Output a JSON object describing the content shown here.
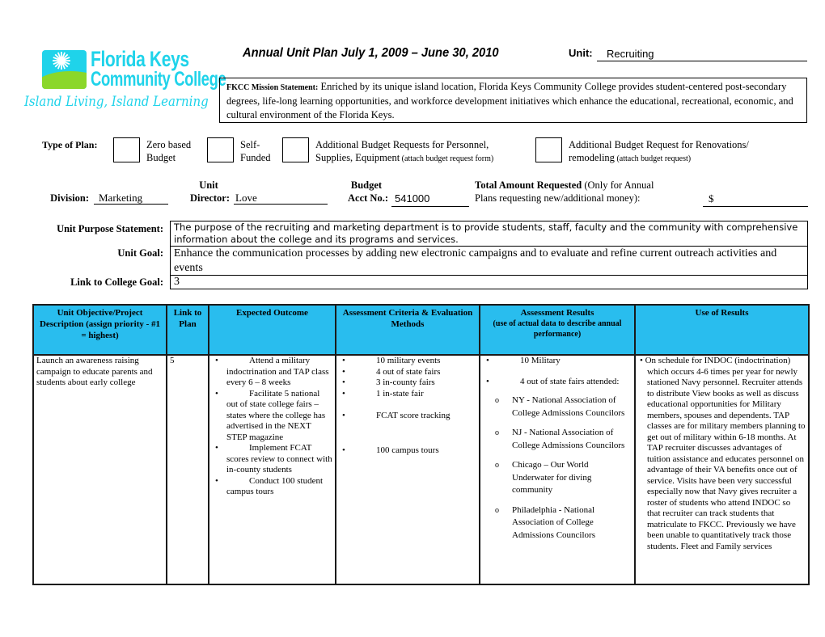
{
  "logo": {
    "line1": "Florida Keys",
    "line2": "Community College",
    "tagline": "Island Living, Island Learning",
    "icon": "dandelion-icon",
    "colors": {
      "cyan": "#1fd3ea",
      "green": "#8bd72a"
    }
  },
  "header": {
    "title": "Annual Unit Plan July 1, 2009 – June 30, 2010",
    "unit_label": "Unit:",
    "unit_value": "Recruiting"
  },
  "mission": {
    "label": "FKCC Mission Statement:",
    "text": " Enriched by its unique island location, Florida Keys Community College provides student-centered post-secondary degrees, life-long learning opportunities, and workforce development initiatives which enhance the educational, recreational, economic, and cultural environment of the Florida Keys."
  },
  "plan_type": {
    "label": "Type of Plan:",
    "options": [
      {
        "line1": "Zero based",
        "line2": "Budget",
        "note": ""
      },
      {
        "line1": "Self-",
        "line2": "Funded",
        "note": ""
      },
      {
        "line1": "Additional Budget Requests for Personnel,",
        "line2": "Supplies, Equipment",
        "note": " (attach budget request form)"
      },
      {
        "line1": "Additional Budget Request for Renovations/",
        "line2": "remodeling",
        "note": " (attach budget request)"
      }
    ]
  },
  "fields": {
    "division_label": "Division:",
    "division_value": "Marketing",
    "director_label_1": "Unit",
    "director_label_2": "Director:",
    "director_value": "Love",
    "acct_label_1": "Budget",
    "acct_label_2": "Acct No.:",
    "acct_value": "541000",
    "total_label_bold": "Total Amount Requested",
    "total_label_rest": " (Only for Annual",
    "total_label_line2": "Plans requesting new/additional money):",
    "total_value": "$"
  },
  "purpose": {
    "purpose_label": "Unit Purpose Statement:",
    "purpose_text": "The purpose of the recruiting and marketing department is to provide students, staff, faculty and the community with comprehensive information about the college and its programs and services.",
    "goal_label": "Unit Goal:",
    "goal_text": "Enhance the communication processes by adding new electronic campaigns and to evaluate and refine current outreach activities and events",
    "link_label": "Link to College Goal:",
    "link_value": "3"
  },
  "table": {
    "header_color": "#29bdee",
    "headers": [
      {
        "title": "Unit Objective/Project Description (assign priority - #1 = highest)",
        "sub": ""
      },
      {
        "title": "Link to Plan",
        "sub": ""
      },
      {
        "title": "Expected Outcome",
        "sub": ""
      },
      {
        "title": "Assessment Criteria & Evaluation Methods",
        "sub": ""
      },
      {
        "title": "Assessment Results",
        "sub": "(use of actual data to describe annual performance)"
      },
      {
        "title": "Use of Results",
        "sub": ""
      }
    ],
    "rows": [
      {
        "objective": "Launch an awareness raising campaign to educate parents and students about early college",
        "link": "5",
        "outcomes": [
          "Attend a military indoctrination and TAP class every 6 – 8 weeks",
          "Facilitate 5 national out of state college fairs – states where the college has advertised in the NEXT STEP magazine",
          "Implement FCAT scores review to connect with in-county students",
          "Conduct 100 student campus tours"
        ],
        "criteria": [
          "10 military events",
          "4 out of state fairs",
          "3 in-county fairs",
          "1 in-state fair",
          "FCAT score tracking",
          "100 campus tours"
        ],
        "results": {
          "items": [
            "10 Military",
            "4 out of state fairs attended:"
          ],
          "sub_items": [
            "NY - National Association of College Admissions Councilors",
            "NJ - National Association of College Admissions Councilors",
            "Chicago – Our World Underwater for diving community",
            "Philadelphia - National Association of College Admissions Councilors"
          ]
        },
        "use_of_results": "On schedule for INDOC (indoctrination) which occurs 4-6 times per year for newly stationed Navy personnel.  Recruiter attends to distribute View books as well as discuss educational opportunities for Military members, spouses and dependents.  TAP classes are for military members planning to get out of military within 6-18 months.  At TAP recruiter discusses advantages of tuition assistance and educates personnel on advantage of their VA benefits once out of service.  Visits have been very successful especially now that Navy gives recruiter a roster of students who attend INDOC so that recruiter can track students that matriculate to FKCC.  Previously we have been unable to quantitatively track those students.  Fleet and Family services"
      }
    ]
  }
}
